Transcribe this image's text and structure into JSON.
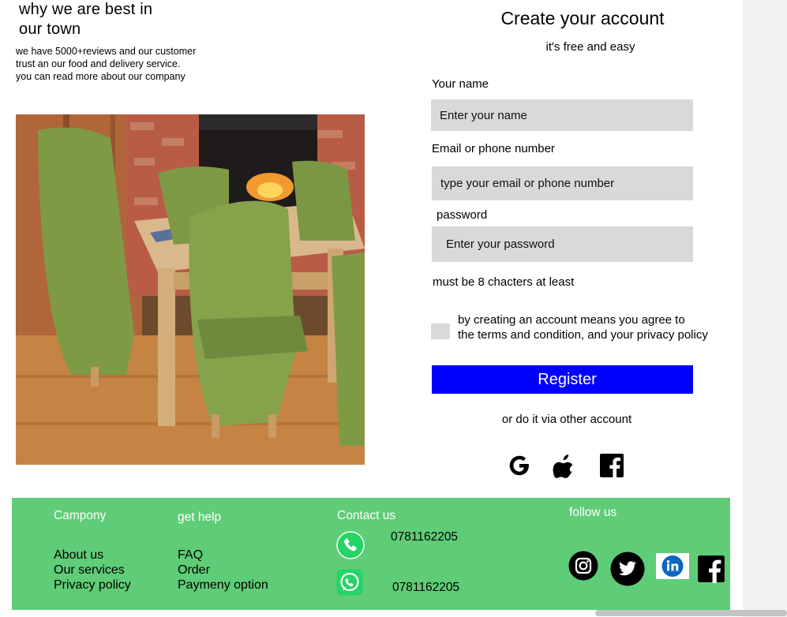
{
  "hero": {
    "title_line1": "why we are best in",
    "title_line2": "our town",
    "desc_line1": "we have 5000+reviews and our customer",
    "desc_line2": "trust an our food and delivery service.",
    "desc_line3": "you can read more about our company"
  },
  "signup": {
    "title": "Create your account",
    "subtitle": "it's free and easy",
    "name_label": "Your name",
    "name_placeholder": "Enter your name",
    "email_label": "Email or phone number",
    "email_placeholder": "type your email or phone number",
    "password_label": "password",
    "password_placeholder": "Enter your password",
    "password_hint": "must be 8 chacters at least",
    "agree_line1": "by creating an account means you agree to",
    "agree_line2": "the terms and condition, and your privacy policy",
    "register_label": "Register",
    "alt_text": "or do it via other account",
    "social_icons": [
      "google-icon",
      "apple-icon",
      "facebook-icon"
    ]
  },
  "footer": {
    "company": {
      "heading": "Campony",
      "links": [
        "About us",
        "Our services",
        "Privacy policy"
      ]
    },
    "help": {
      "heading": "get help",
      "links": [
        "FAQ",
        "Order",
        "Paymeny option"
      ]
    },
    "contact": {
      "heading": "Contact us",
      "phone": "0781162205",
      "whatsapp": "0781162205"
    },
    "follow": {
      "heading": "follow us",
      "icons": [
        "instagram-icon",
        "twitter-icon",
        "linkedin-icon",
        "facebook-icon"
      ]
    }
  },
  "colors": {
    "register_button": "#0000ff",
    "footer_background": "#5fcc78",
    "input_background": "#d9d9d9",
    "phone_icon": "#25d366",
    "linkedin": "#0a66c2"
  }
}
